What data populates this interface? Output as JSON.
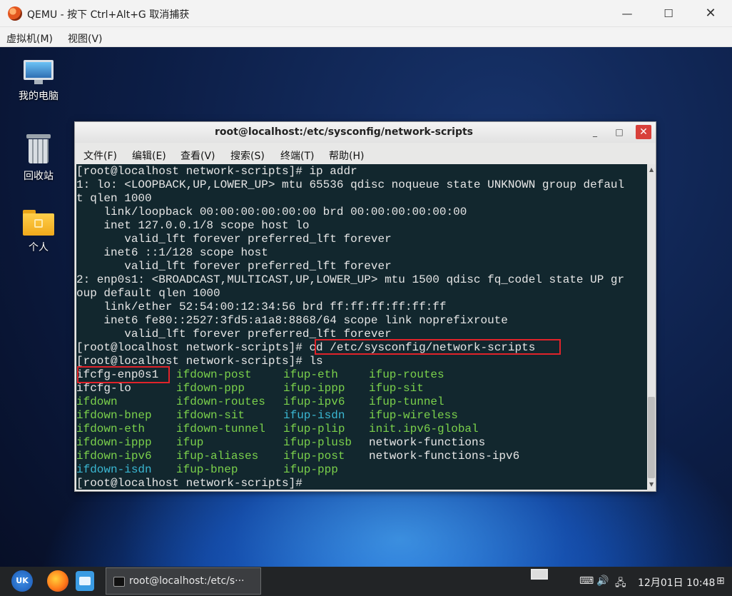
{
  "qemu": {
    "title": "QEMU - 按下 Ctrl+Alt+G 取消捕获",
    "menu": [
      "虚拟机(M)",
      "视图(V)"
    ],
    "controls": {
      "minimize": "—",
      "maximize": "☐",
      "close": "✕"
    }
  },
  "desktop": {
    "icons": [
      {
        "label": "我的电脑",
        "icon": "computer-icon"
      },
      {
        "label": "回收站",
        "icon": "trash-icon"
      },
      {
        "label": "个人",
        "icon": "home-folder-icon"
      }
    ]
  },
  "terminal": {
    "title": "root@localhost:/etc/sysconfig/network-scripts",
    "controls": {
      "minimize": "_",
      "maximize": "□",
      "close": "✕"
    },
    "menu": [
      "文件(F)",
      "编辑(E)",
      "查看(V)",
      "搜索(S)",
      "终端(T)",
      "帮助(H)"
    ],
    "lines": [
      "[root@localhost network-scripts]# ip addr",
      "1: lo: <LOOPBACK,UP,LOWER_UP> mtu 65536 qdisc noqueue state UNKNOWN group defaul",
      "t qlen 1000",
      "    link/loopback 00:00:00:00:00:00 brd 00:00:00:00:00:00",
      "    inet 127.0.0.1/8 scope host lo",
      "       valid_lft forever preferred_lft forever",
      "    inet6 ::1/128 scope host",
      "       valid_lft forever preferred_lft forever",
      "2: enp0s1: <BROADCAST,MULTICAST,UP,LOWER_UP> mtu 1500 qdisc fq_codel state UP gr",
      "oup default qlen 1000",
      "    link/ether 52:54:00:12:34:56 brd ff:ff:ff:ff:ff:ff",
      "    inet6 fe80::2527:3fd5:a1a8:8868/64 scope link noprefixroute",
      "       valid_lft forever preferred_lft forever",
      "[root@localhost network-scripts]# cd /etc/sysconfig/network-scripts",
      "[root@localhost network-scripts]# ls"
    ],
    "ls_rows": [
      [
        {
          "text": "ifcfg-enp0s1",
          "color": "white"
        },
        {
          "text": "ifdown-post",
          "color": "green"
        },
        {
          "text": "ifup-eth",
          "color": "green"
        },
        {
          "text": "ifup-routes",
          "color": "green"
        }
      ],
      [
        {
          "text": "ifcfg-lo",
          "color": "white"
        },
        {
          "text": "ifdown-ppp",
          "color": "green"
        },
        {
          "text": "ifup-ippp",
          "color": "green"
        },
        {
          "text": "ifup-sit",
          "color": "green"
        }
      ],
      [
        {
          "text": "ifdown",
          "color": "green"
        },
        {
          "text": "ifdown-routes",
          "color": "green"
        },
        {
          "text": "ifup-ipv6",
          "color": "green"
        },
        {
          "text": "ifup-tunnel",
          "color": "green"
        }
      ],
      [
        {
          "text": "ifdown-bnep",
          "color": "green"
        },
        {
          "text": "ifdown-sit",
          "color": "green"
        },
        {
          "text": "ifup-isdn",
          "color": "cyan"
        },
        {
          "text": "ifup-wireless",
          "color": "green"
        }
      ],
      [
        {
          "text": "ifdown-eth",
          "color": "green"
        },
        {
          "text": "ifdown-tunnel",
          "color": "green"
        },
        {
          "text": "ifup-plip",
          "color": "green"
        },
        {
          "text": "init.ipv6-global",
          "color": "green"
        }
      ],
      [
        {
          "text": "ifdown-ippp",
          "color": "green"
        },
        {
          "text": "ifup",
          "color": "green"
        },
        {
          "text": "ifup-plusb",
          "color": "green"
        },
        {
          "text": "network-functions",
          "color": "white"
        }
      ],
      [
        {
          "text": "ifdown-ipv6",
          "color": "green"
        },
        {
          "text": "ifup-aliases",
          "color": "green"
        },
        {
          "text": "ifup-post",
          "color": "green"
        },
        {
          "text": "network-functions-ipv6",
          "color": "white"
        }
      ],
      [
        {
          "text": "ifdown-isdn",
          "color": "cyan"
        },
        {
          "text": "ifup-bnep",
          "color": "green"
        },
        {
          "text": "ifup-ppp",
          "color": "green"
        }
      ]
    ],
    "prompt": "[root@localhost network-scripts]#",
    "colors": {
      "background": "#12272e",
      "text": "#e6e6e6",
      "green": "#7bd14b",
      "cyan": "#3ab7d2",
      "highlight": "#e0232a"
    }
  },
  "taskbar": {
    "start_label": "UK",
    "task_label": "root@localhost:/etc/s···",
    "tray": {
      "keyboard": "⌨",
      "volume": "🔊",
      "network": "🖧",
      "notify": "⊞"
    },
    "clock": "12月01日 10:48"
  }
}
